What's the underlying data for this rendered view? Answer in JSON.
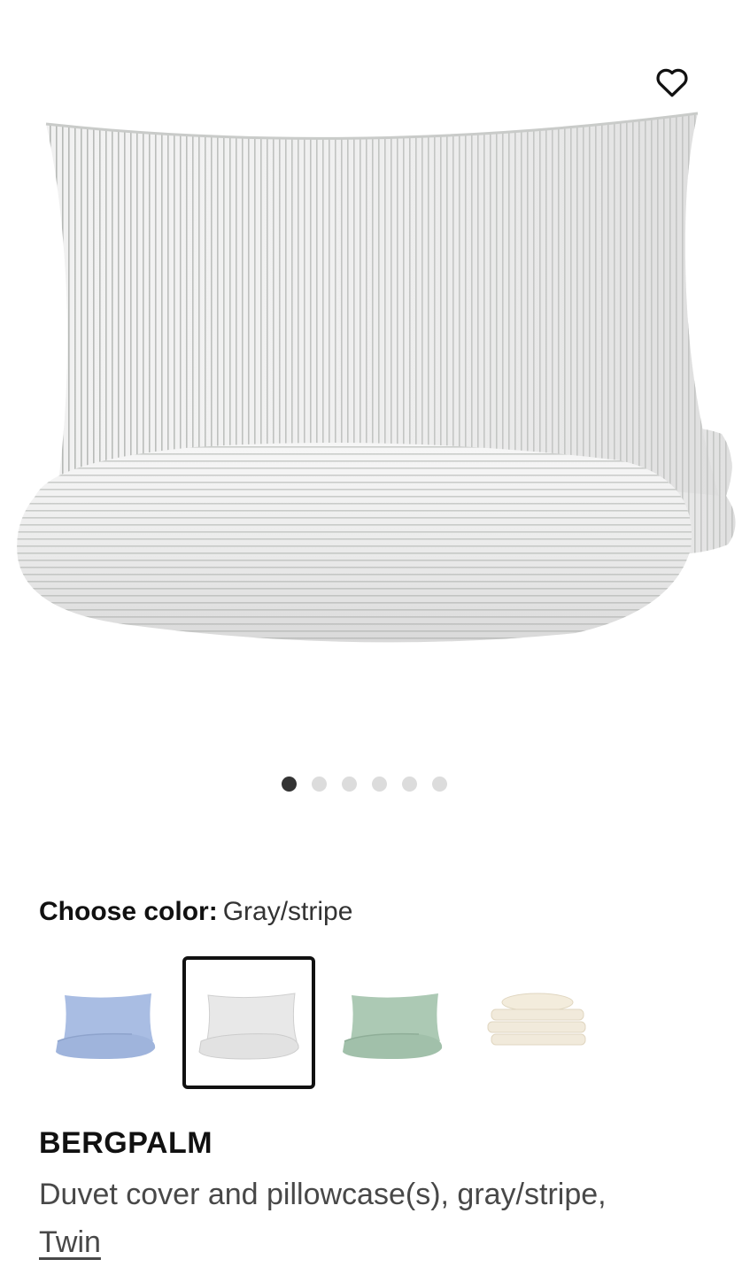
{
  "favorite": {
    "icon": "heart-outline-icon"
  },
  "gallery": {
    "total_images": 6,
    "active_index": 0
  },
  "color_chooser": {
    "label": "Choose color:",
    "selected_value": "Gray/stripe",
    "options": [
      {
        "name": "light blue",
        "color": "#a9bde3",
        "selected": false
      },
      {
        "name": "gray/stripe",
        "color": "#e6e6e6",
        "selected": true
      },
      {
        "name": "green",
        "color": "#a9c7b2",
        "selected": false
      },
      {
        "name": "white/beige",
        "color": "#f1eadb",
        "selected": false
      }
    ]
  },
  "product": {
    "name": "BERGPALM",
    "description": "Duvet cover and pillowcase(s), gray/stripe,",
    "size": "Twin"
  },
  "colors": {
    "text": "#111111",
    "secondary_text": "#484848",
    "dot_active": "#333333",
    "dot_inactive": "#dcdcdc"
  }
}
